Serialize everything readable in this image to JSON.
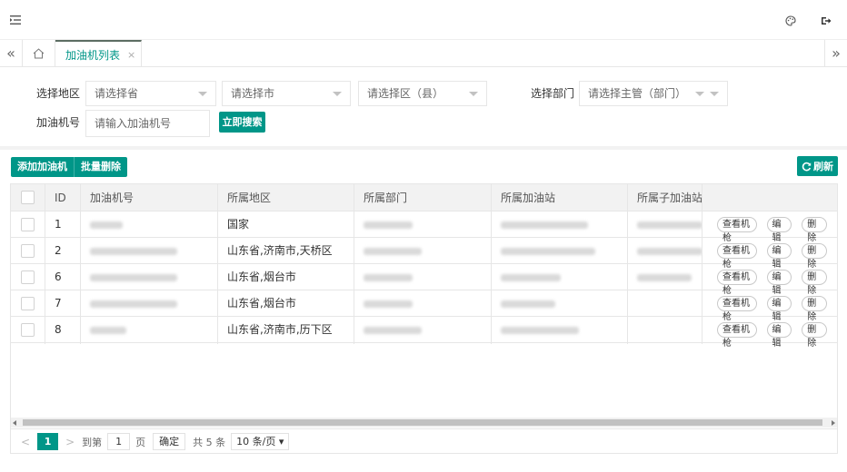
{
  "topbar": {
    "menu_icon": "menu-indent-icon",
    "theme_icon": "palette-icon",
    "logout_icon": "logout-icon"
  },
  "tabs": {
    "prev": "«",
    "next": "»",
    "active": {
      "label": "加油机列表",
      "close": "×"
    }
  },
  "search": {
    "region_label": "选择地区",
    "province_placeholder": "请选择省",
    "city_placeholder": "请选择市",
    "district_placeholder": "请选择区（县）",
    "dept_label": "选择部门",
    "dept_placeholder": "请选择主管（部门）",
    "machine_label": "加油机号",
    "machine_placeholder": "请输入加油机号",
    "search_button": "立即搜索"
  },
  "toolbar": {
    "add_button": "添加加油机",
    "batch_delete_button": "批量删除",
    "refresh_button": "刷新"
  },
  "table": {
    "columns": [
      "ID",
      "加油机号",
      "所属地区",
      "所属部门",
      "所属加油站",
      "所属子加油站"
    ],
    "rows": [
      {
        "id": "1",
        "region": "国家",
        "action_view": "查看机枪",
        "action_edit": "编辑",
        "action_delete": "删除"
      },
      {
        "id": "2",
        "region": "山东省,济南市,天桥区",
        "action_view": "查看机枪",
        "action_edit": "编辑",
        "action_delete": "删除"
      },
      {
        "id": "6",
        "region": "山东省,烟台市",
        "action_view": "查看机枪",
        "action_edit": "编辑",
        "action_delete": "删除"
      },
      {
        "id": "7",
        "region": "山东省,烟台市",
        "action_view": "查看机枪",
        "action_edit": "编辑",
        "action_delete": "删除"
      },
      {
        "id": "8",
        "region": "山东省,济南市,历下区",
        "action_view": "查看机枪",
        "action_edit": "编辑",
        "action_delete": "删除"
      }
    ]
  },
  "pagination": {
    "prev": "<",
    "current_page": "1",
    "next": ">",
    "goto_label": "到第",
    "goto_value": "1",
    "page_unit": "页",
    "confirm": "确定",
    "total": "共 5 条",
    "page_size": "10 条/页"
  },
  "colors": {
    "accent": "#009688",
    "border": "#e6e6e6",
    "header_bg": "#f2f2f2"
  }
}
